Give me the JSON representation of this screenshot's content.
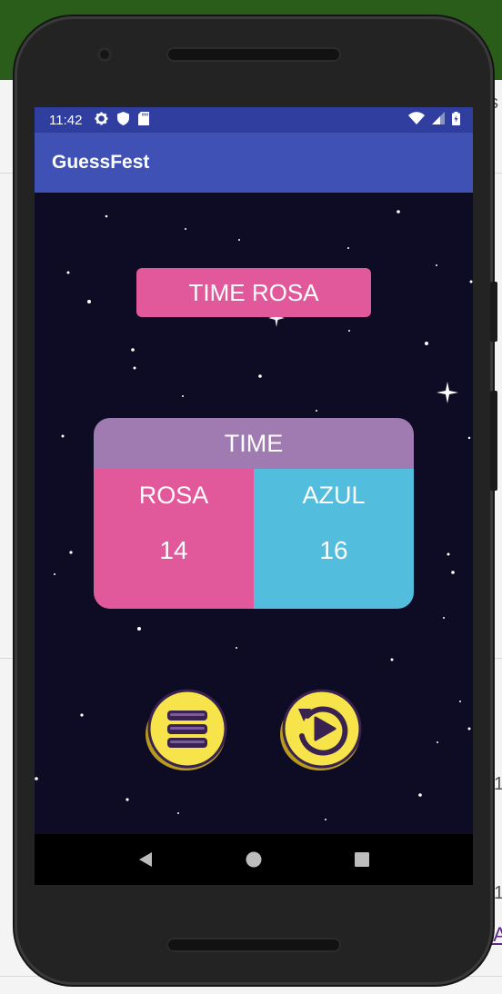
{
  "status_bar": {
    "time": "11:42",
    "icons": [
      "gear-icon",
      "shield-icon",
      "sd-card-icon"
    ],
    "right_icons": [
      "wifi-icon",
      "signal-icon",
      "battery-charging-icon"
    ]
  },
  "app": {
    "title": "GuessFest",
    "primary_color": "#3f51b5",
    "status_color": "#303f9f"
  },
  "game": {
    "current_team": "TIME ROSA",
    "scoreboard": {
      "header": "TIME",
      "teams": [
        {
          "name": "ROSA",
          "score": "14",
          "color": "#e1589b"
        },
        {
          "name": "AZUL",
          "score": "16",
          "color": "#52bddc"
        }
      ]
    },
    "buttons": {
      "menu": "menu-icon",
      "replay": "replay-play-icon"
    }
  },
  "nav_bar": {
    "buttons": [
      "back-icon",
      "home-icon",
      "recents-icon"
    ]
  },
  "host": {
    "right_fragments": [
      "s",
      "1",
      "1",
      "eA"
    ]
  }
}
